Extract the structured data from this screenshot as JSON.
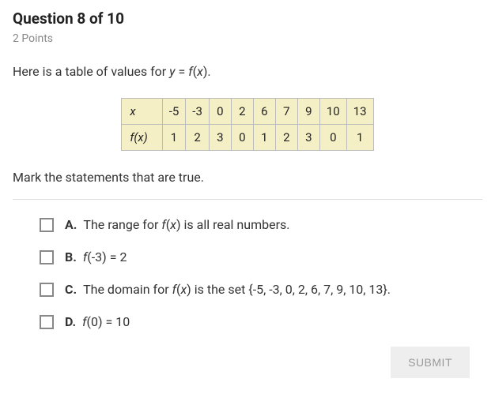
{
  "header": {
    "title": "Question 8 of 10",
    "points": "2 Points"
  },
  "intro": {
    "prefix": "Here is a table of values for ",
    "y": "y",
    "eq": " = ",
    "f": "f",
    "lp": "(",
    "x": "x",
    "rp": ").",
    "suffix": ""
  },
  "table": {
    "row1_label_x": "x",
    "row2_label_f": "f",
    "row2_label_lp": "(",
    "row2_label_x": "x",
    "row2_label_rp": ")",
    "x_vals": [
      "-5",
      "-3",
      "0",
      "2",
      "6",
      "7",
      "9",
      "10",
      "13"
    ],
    "f_vals": [
      "1",
      "2",
      "3",
      "0",
      "1",
      "2",
      "3",
      "0",
      "1"
    ]
  },
  "instruction": "Mark the statements that are true.",
  "choices": {
    "a": {
      "letter": "A.",
      "t1": "The range for ",
      "f": "f",
      "lp": "(",
      "x": "x",
      "rp": ")",
      "t2": " is all real numbers."
    },
    "b": {
      "letter": "B.",
      "f": "f",
      "text": "(-3) = 2"
    },
    "c": {
      "letter": "C.",
      "t1": "The domain for ",
      "f": "f",
      "lp": "(",
      "x": "x",
      "rp": ")",
      "t2": " is the set {-5, -3, 0, 2, 6, 7, 9, 10, 13}."
    },
    "d": {
      "letter": "D.",
      "f": "f",
      "text": "(0) = 10"
    }
  },
  "submit_label": "SUBMIT"
}
